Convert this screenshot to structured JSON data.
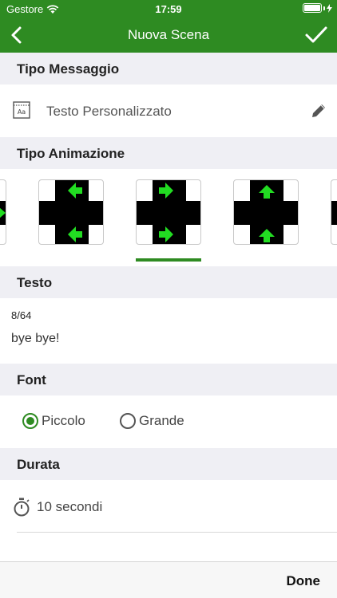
{
  "status_bar": {
    "carrier": "Gestore",
    "time": "17:59"
  },
  "nav": {
    "title": "Nuova Scena",
    "back_icon": "chevron-left-icon",
    "confirm_icon": "checkmark-icon"
  },
  "sections": {
    "message_type": {
      "header": "Tipo Messaggio",
      "value": "Testo Personalizzato",
      "icon": "text-frame-icon",
      "edit_icon": "pencil-icon"
    },
    "animation_type": {
      "header": "Tipo Animazione",
      "options": [
        {
          "name": "partial-left",
          "arrow_dir": "right"
        },
        {
          "name": "left",
          "arrow_dir": "left"
        },
        {
          "name": "right",
          "arrow_dir": "right"
        },
        {
          "name": "up",
          "arrow_dir": "up"
        },
        {
          "name": "partial-right",
          "arrow_dir": "down"
        }
      ],
      "selected_index": 2
    },
    "text": {
      "header": "Testo",
      "counter": "8/64",
      "value": "bye bye!"
    },
    "font": {
      "header": "Font",
      "options": [
        {
          "label": "Piccolo",
          "selected": true
        },
        {
          "label": "Grande",
          "selected": false
        }
      ]
    },
    "duration": {
      "header": "Durata",
      "value": "10 secondi",
      "icon": "stopwatch-icon"
    }
  },
  "toolbar": {
    "done_label": "Done"
  },
  "colors": {
    "primary": "#2e8b22",
    "section_bg": "#efeff4",
    "arrow": "#22dd22"
  }
}
